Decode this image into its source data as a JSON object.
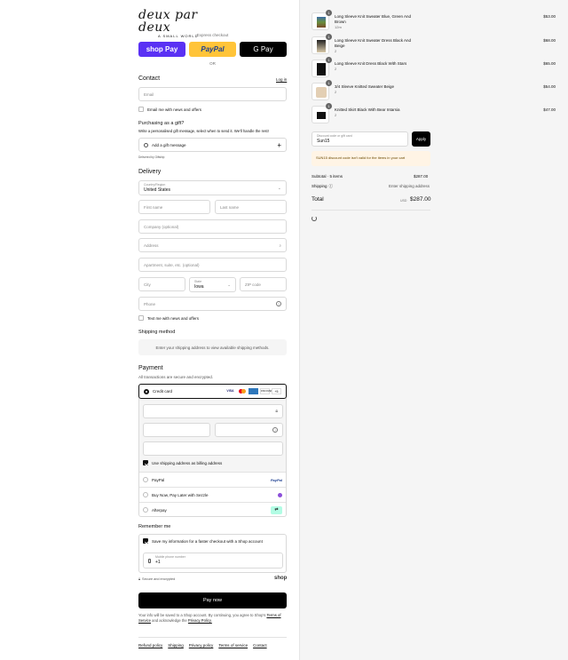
{
  "brand": {
    "logo_script": "deux par deux",
    "tagline": "A SMALL WORLD"
  },
  "express": {
    "label": "Express checkout",
    "shop_pay": "shop Pay",
    "paypal": "PayPal",
    "gpay": "G Pay",
    "or": "OR"
  },
  "contact": {
    "title": "Contact",
    "login": "Log in",
    "email_placeholder": "Email",
    "news_label": "Email me with news and offers"
  },
  "gift": {
    "title": "Purchasing as a gift?",
    "desc": "Write a personalised gift message, select when to send it. We'll handle the rest!",
    "add_label": "Add a gift message",
    "powered": "Delivered by Giftship"
  },
  "delivery": {
    "title": "Delivery",
    "country_label": "Country/Region",
    "country_value": "United States",
    "first": "First name",
    "last": "Last name",
    "company": "Company (optional)",
    "address": "Address",
    "apt": "Apartment, suite, etc. (optional)",
    "city": "City",
    "state_label": "State",
    "state_value": "Iowa",
    "zip": "ZIP code",
    "phone": "Phone",
    "text_label": "Text me with news and offers"
  },
  "shipping": {
    "title": "Shipping method",
    "notice": "Enter your shipping address to view available shipping methods."
  },
  "payment": {
    "title": "Payment",
    "secure": "All transactions are secure and encrypted.",
    "credit": "Credit card",
    "more": "+5",
    "billing": "Use shipping address as billing address",
    "paypal": "PayPal",
    "sezzle": "Buy Now, Pay Later with Sezzle",
    "afterpay": "Afterpay",
    "paypal_logo": "PayPal"
  },
  "remember": {
    "title": "Remember me",
    "save": "Save my information for a faster checkout with a Shop account",
    "phone_label": "Mobile phone number",
    "phone_value": "+1",
    "secure": "Secure and encrypted",
    "shop": "shop"
  },
  "pay_now": "Pay now",
  "legal": {
    "text": "Your info will be saved to a Shop account. By continuing, you agree to Shop's",
    "terms": "Terms of Service",
    "and": "and acknowledge the",
    "privacy": "Privacy Policy."
  },
  "footer": [
    "Refund policy",
    "Shipping",
    "Privacy policy",
    "Terms of service",
    "Contact"
  ],
  "cart": {
    "items": [
      {
        "qty": "1",
        "name": "Long Sleeve Knit Sweater Blue, Green And Brown",
        "sub": "12m",
        "price": "$53.00"
      },
      {
        "qty": "1",
        "name": "Long Sleeve Knit Sweater Dress Black And Beige",
        "sub": "2",
        "price": "$68.00"
      },
      {
        "qty": "1",
        "name": "Long Sleeve Knit Dress Black With Stars",
        "sub": "2",
        "price": "$65.00"
      },
      {
        "qty": "1",
        "name": "3/4 Sleeve Knitted Sweater Beige",
        "sub": "2",
        "price": "$54.00"
      },
      {
        "qty": "1",
        "name": "Knitted Skirt Black With Bear Intarsia",
        "sub": "2",
        "price": "$47.00"
      }
    ],
    "discount_label": "Discount code or gift card",
    "discount_value": "Sun15",
    "apply": "Apply",
    "error": "SUN15 discount code isn't valid for the items in your cart",
    "subtotal_label": "Subtotal · 5 items",
    "subtotal": "$287.00",
    "shipping_label": "Shipping",
    "shipping_value": "Enter shipping address",
    "total_label": "Total",
    "currency": "USD",
    "total": "$287.00"
  },
  "colors": {
    "shop_pay": "#5a31f4",
    "paypal": "#ffc439",
    "accent": "#111111",
    "error_bg": "#fff4e5"
  }
}
